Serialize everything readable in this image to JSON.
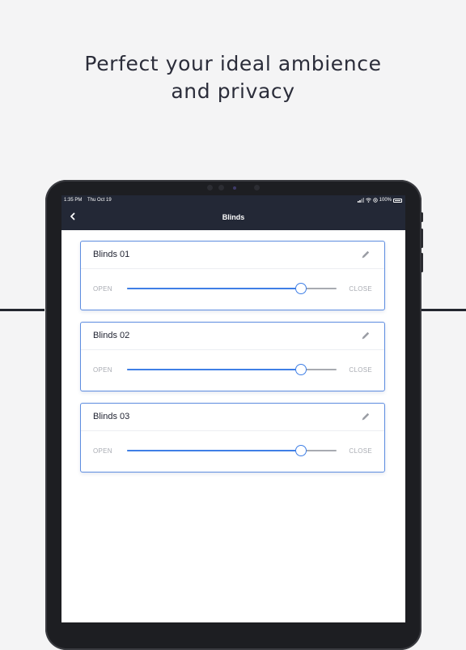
{
  "promo": {
    "headline_line1": "Perfect your ideal ambience",
    "headline_line2": "and privacy"
  },
  "status_bar": {
    "time": "1:35 PM",
    "date": "Thu Oct 19",
    "battery": "100%",
    "icons": [
      "signal-icon",
      "wifi-icon",
      "location-icon",
      "battery-icon"
    ]
  },
  "nav": {
    "title": "Blinds",
    "back_icon": "chevron-left-icon"
  },
  "blinds": [
    {
      "name": "Blinds 01",
      "open_label": "OPEN",
      "close_label": "CLOSE",
      "position": 0.83
    },
    {
      "name": "Blinds 02",
      "open_label": "OPEN",
      "close_label": "CLOSE",
      "position": 0.83
    },
    {
      "name": "Blinds 03",
      "open_label": "OPEN",
      "close_label": "CLOSE",
      "position": 0.83
    }
  ],
  "colors": {
    "background": "#f4f4f5",
    "nav_bar": "#232836",
    "accent": "#3f7fe6",
    "card_border": "#5e8de0",
    "muted_text": "#a9acb3"
  }
}
